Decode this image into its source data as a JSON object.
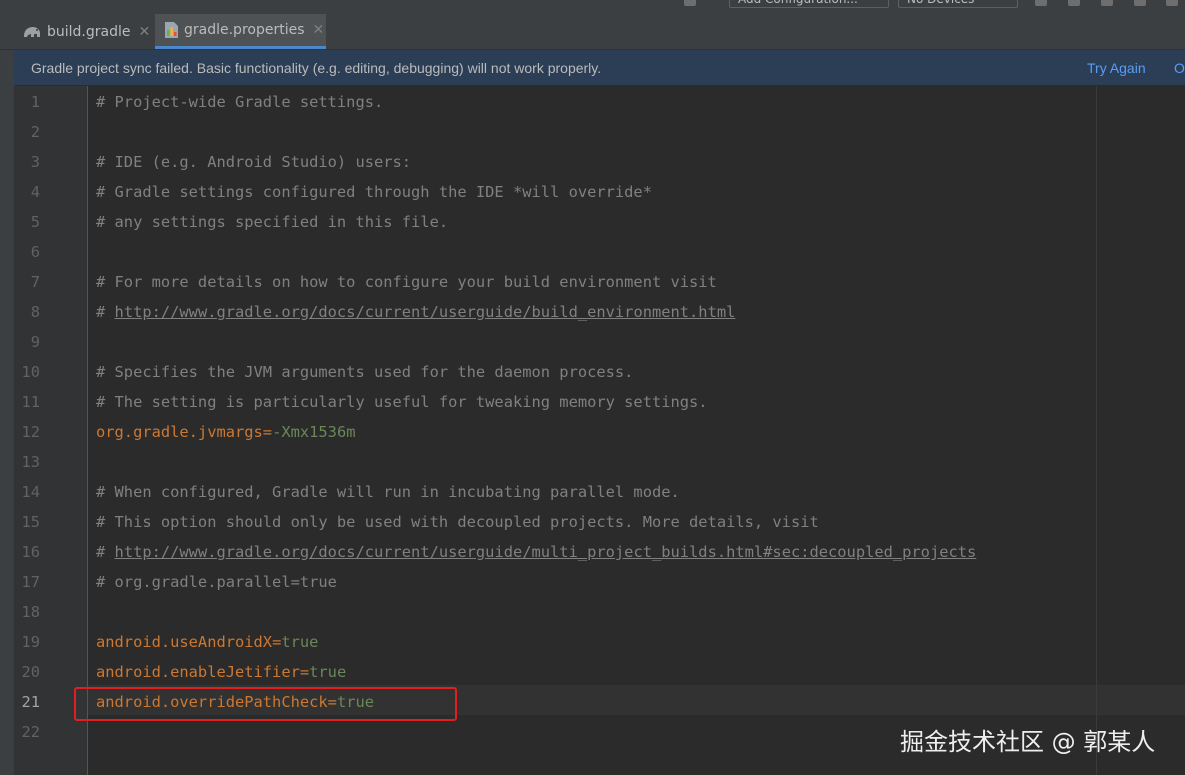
{
  "toolbar": {
    "run_config_label": "Add Configuration...",
    "device_label": "No Devices"
  },
  "tabs": [
    {
      "label": "build.gradle",
      "icon": "gradle-elephant-icon",
      "active": false
    },
    {
      "label": "gradle.properties",
      "icon": "properties-file-icon",
      "active": true
    }
  ],
  "banner": {
    "message": "Gradle project sync failed. Basic functionality (e.g. editing, debugging) will not work properly.",
    "try_again": "Try Again",
    "open_partial": "O"
  },
  "editor": {
    "current_line": 21,
    "lines": [
      {
        "n": "1",
        "text": "# Project-wide Gradle settings."
      },
      {
        "n": "2",
        "text": ""
      },
      {
        "n": "3",
        "text": "# IDE (e.g. Android Studio) users:"
      },
      {
        "n": "4",
        "text": "# Gradle settings configured through the IDE *will override*"
      },
      {
        "n": "5",
        "text": "# any settings specified in this file."
      },
      {
        "n": "6",
        "text": ""
      },
      {
        "n": "7",
        "text": "# For more details on how to configure your build environment visit"
      },
      {
        "n": "8",
        "prefix": "# ",
        "url": "http://www.gradle.org/docs/current/userguide/build_environment.html"
      },
      {
        "n": "9",
        "text": ""
      },
      {
        "n": "10",
        "text": "# Specifies the JVM arguments used for the daemon process."
      },
      {
        "n": "11",
        "text": "# The setting is particularly useful for tweaking memory settings."
      },
      {
        "n": "12",
        "key": "org.gradle.jvmargs",
        "eq": "=",
        "value": "-Xmx1536m"
      },
      {
        "n": "13",
        "text": ""
      },
      {
        "n": "14",
        "text": "# When configured, Gradle will run in incubating parallel mode."
      },
      {
        "n": "15",
        "text": "# This option should only be used with decoupled projects. More details, visit"
      },
      {
        "n": "16",
        "prefix": "# ",
        "url": "http://www.gradle.org/docs/current/userguide/multi_project_builds.html#sec:decoupled_projects"
      },
      {
        "n": "17",
        "text": "# org.gradle.parallel=true"
      },
      {
        "n": "18",
        "text": ""
      },
      {
        "n": "19",
        "key": "android.useAndroidX",
        "eq": "=",
        "value": "true"
      },
      {
        "n": "20",
        "key": "android.enableJetifier",
        "eq": "=",
        "value": "true"
      },
      {
        "n": "21",
        "key": "android.overridePathCheck",
        "eq": "=",
        "value": "true"
      },
      {
        "n": "22",
        "text": ""
      }
    ]
  },
  "watermark": "掘金技术社区 @ 郭某人",
  "colors": {
    "banner_bg": "#2c3e55",
    "link": "#589df6",
    "key": "#cc7832",
    "value": "#6a8759",
    "comment": "#808080",
    "highlight": "#e02020"
  }
}
